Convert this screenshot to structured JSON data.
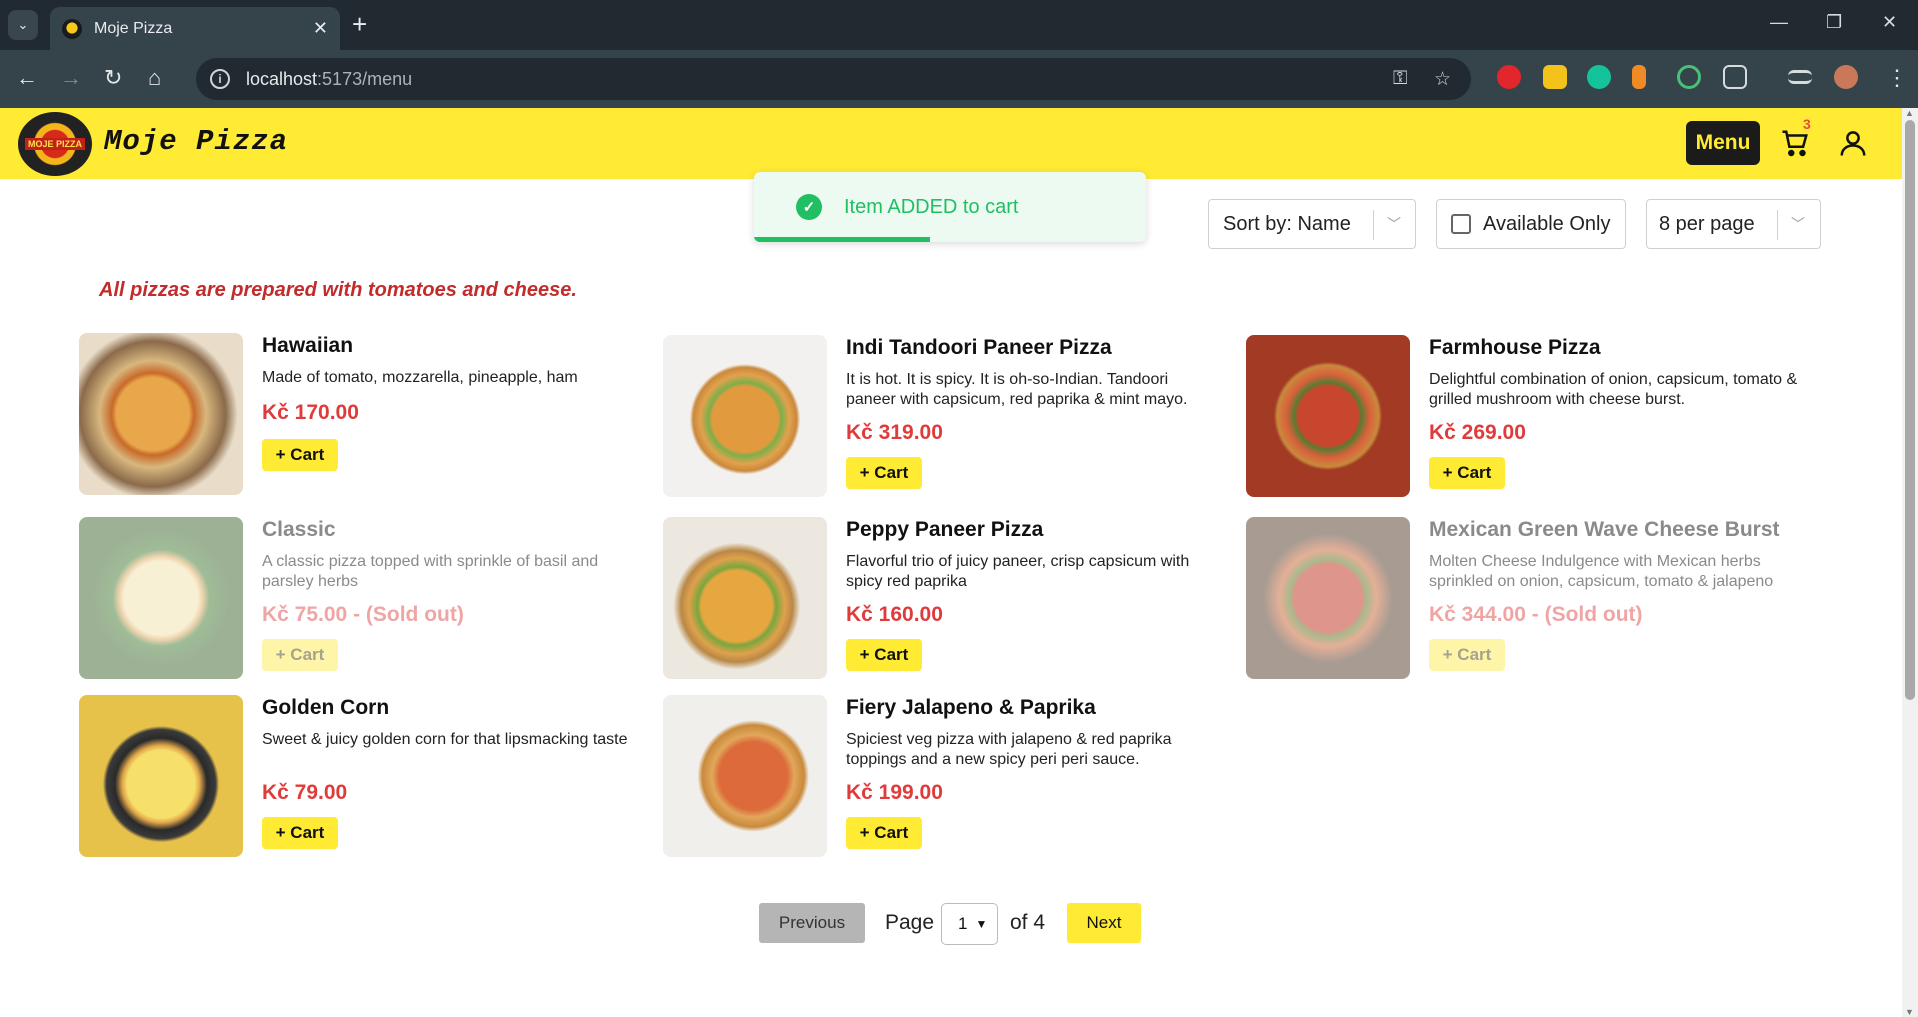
{
  "browser": {
    "tab_title": "Moje Pizza",
    "url_host": "localhost",
    "url_rest": ":5173/menu"
  },
  "header": {
    "logo_text": "MOJE PIZZA",
    "brand": "Moje Pizza",
    "menu_label": "Menu",
    "cart_count": "3"
  },
  "toast": {
    "message": "Item ADDED to cart",
    "progress": 0.45
  },
  "controls": {
    "sort_label": "Sort by: Name",
    "available_label": "Available Only",
    "available_checked": false,
    "per_page_label": "8 per page"
  },
  "note": "All pizzas are prepared with tomatoes and cheese.",
  "items": [
    {
      "name": "Hawaiian",
      "desc": "Made of tomato, mozzarella, pineapple, ham",
      "price": "Kč 170.00",
      "cart": "+ Cart",
      "sold_out": false
    },
    {
      "name": "Indi Tandoori Paneer Pizza",
      "desc": "It is hot. It is spicy. It is oh-so-Indian. Tandoori paneer with capsicum, red paprika & mint mayo.",
      "price": "Kč 319.00",
      "cart": "+ Cart",
      "sold_out": false
    },
    {
      "name": "Farmhouse Pizza",
      "desc": "Delightful combination of onion, capsicum, tomato & grilled mushroom with cheese burst.",
      "price": "Kč 269.00",
      "cart": "+ Cart",
      "sold_out": false
    },
    {
      "name": "Classic",
      "desc": "A classic pizza topped with sprinkle of basil and parsley herbs",
      "price": "Kč 75.00 - (Sold out)",
      "cart": "+ Cart",
      "sold_out": true
    },
    {
      "name": "Peppy Paneer Pizza",
      "desc": "Flavorful trio of juicy paneer, crisp capsicum with spicy red paprika",
      "price": "Kč 160.00",
      "cart": "+ Cart",
      "sold_out": false
    },
    {
      "name": "Mexican Green Wave Cheese Burst",
      "desc": "Molten Cheese Indulgence with Mexican herbs sprinkled on onion, capsicum, tomato & jalapeno",
      "price": "Kč 344.00 - (Sold out)",
      "cart": "+ Cart",
      "sold_out": true
    },
    {
      "name": "Golden Corn",
      "desc": "Sweet & juicy golden corn for that lipsmacking taste",
      "price": "Kč 79.00",
      "cart": "+ Cart",
      "sold_out": false
    },
    {
      "name": "Fiery Jalapeno & Paprika",
      "desc": "Spiciest veg pizza with jalapeno & red paprika toppings and a new spicy peri peri sauce.",
      "price": "Kč 199.00",
      "cart": "+ Cart",
      "sold_out": false
    }
  ],
  "pagination": {
    "previous": "Previous",
    "page_label": "Page",
    "current_page": "1",
    "of_label": "of 4",
    "next": "Next"
  }
}
